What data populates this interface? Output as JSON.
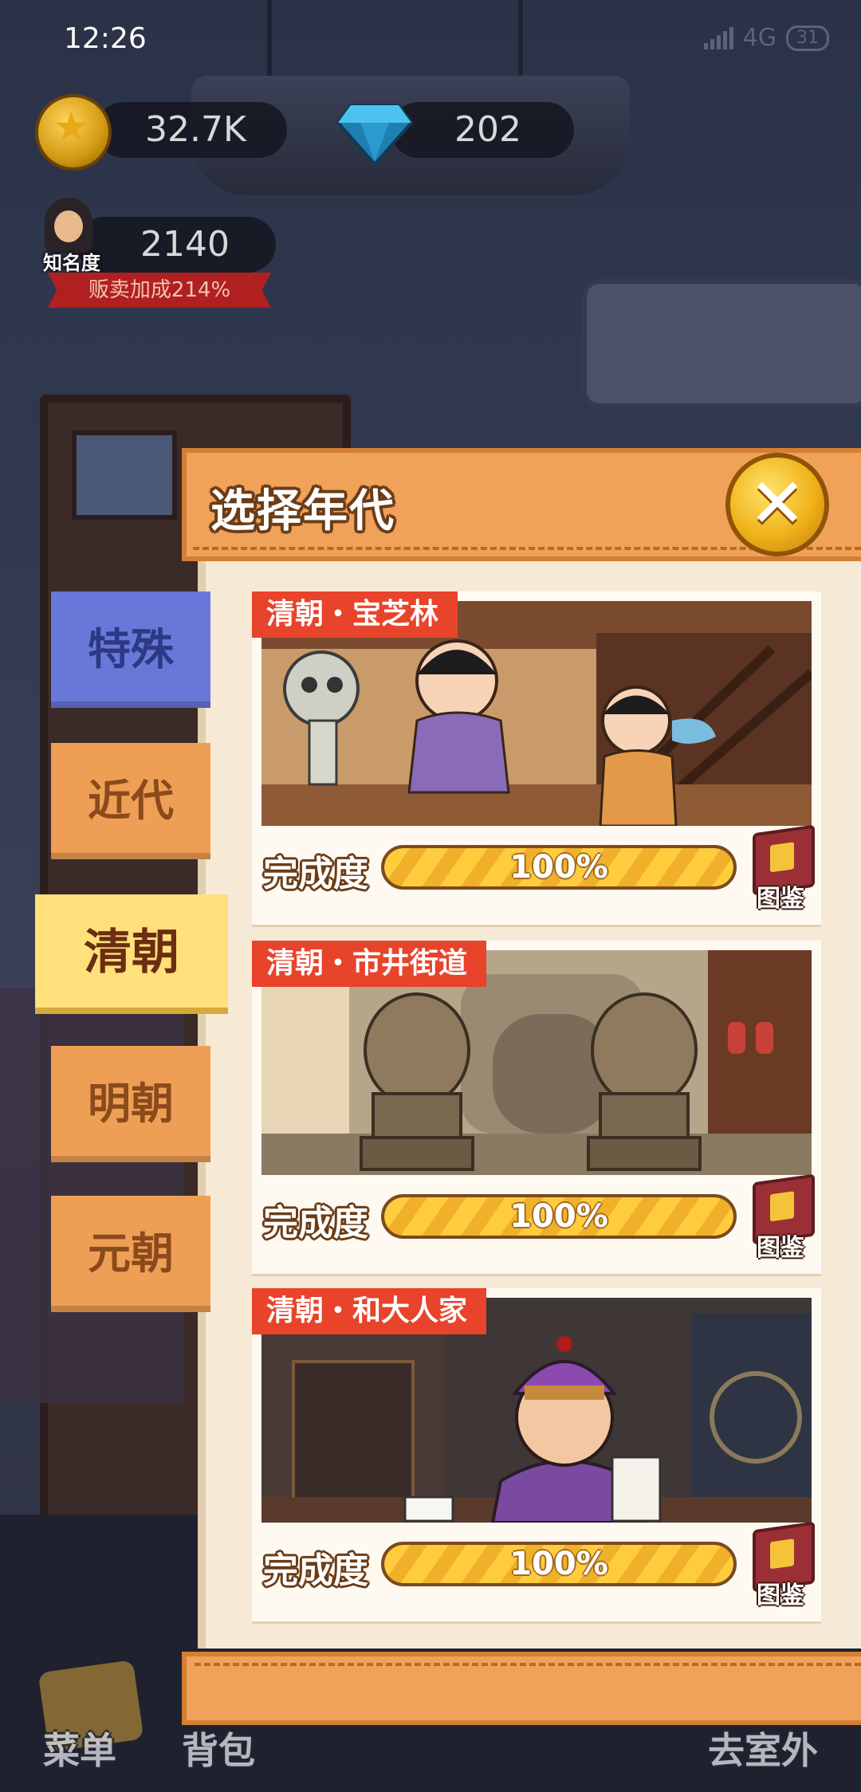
{
  "status_bar": {
    "time": "12:26",
    "network": "4G",
    "battery": "31"
  },
  "currency": {
    "coins": "32.7K",
    "gems": "202"
  },
  "fame": {
    "label": "知名度",
    "value": "2140",
    "bonus": "贩卖加成214%"
  },
  "modal": {
    "title": "选择年代",
    "close_icon": "close-x-icon",
    "tabs": [
      {
        "label": "特殊",
        "color": "#6978d8",
        "active": false
      },
      {
        "label": "近代",
        "color": "#ef9f55",
        "active": false
      },
      {
        "label": "清朝",
        "color": "#ffe07a",
        "active": true
      },
      {
        "label": "明朝",
        "color": "#ef9f55",
        "active": false
      },
      {
        "label": "元朝",
        "color": "#ef9f55",
        "active": false
      }
    ],
    "scenes": [
      {
        "tag": "清朝・宝芝林",
        "progress_label": "完成度",
        "progress": 100,
        "progress_text": "100%",
        "book_label": "图鉴"
      },
      {
        "tag": "清朝・市井街道",
        "progress_label": "完成度",
        "progress": 100,
        "progress_text": "100%",
        "book_label": "图鉴"
      },
      {
        "tag": "清朝・和大人家",
        "progress_label": "完成度",
        "progress": 100,
        "progress_text": "100%",
        "book_label": "图鉴"
      }
    ]
  },
  "bottom_nav": {
    "menu": "菜单",
    "bag": "背包",
    "outdoor": "去室外"
  },
  "colors": {
    "accent_orange": "#f0a25a",
    "tag_red": "#e8432b",
    "progress_yellow": "#ffcc3e"
  }
}
